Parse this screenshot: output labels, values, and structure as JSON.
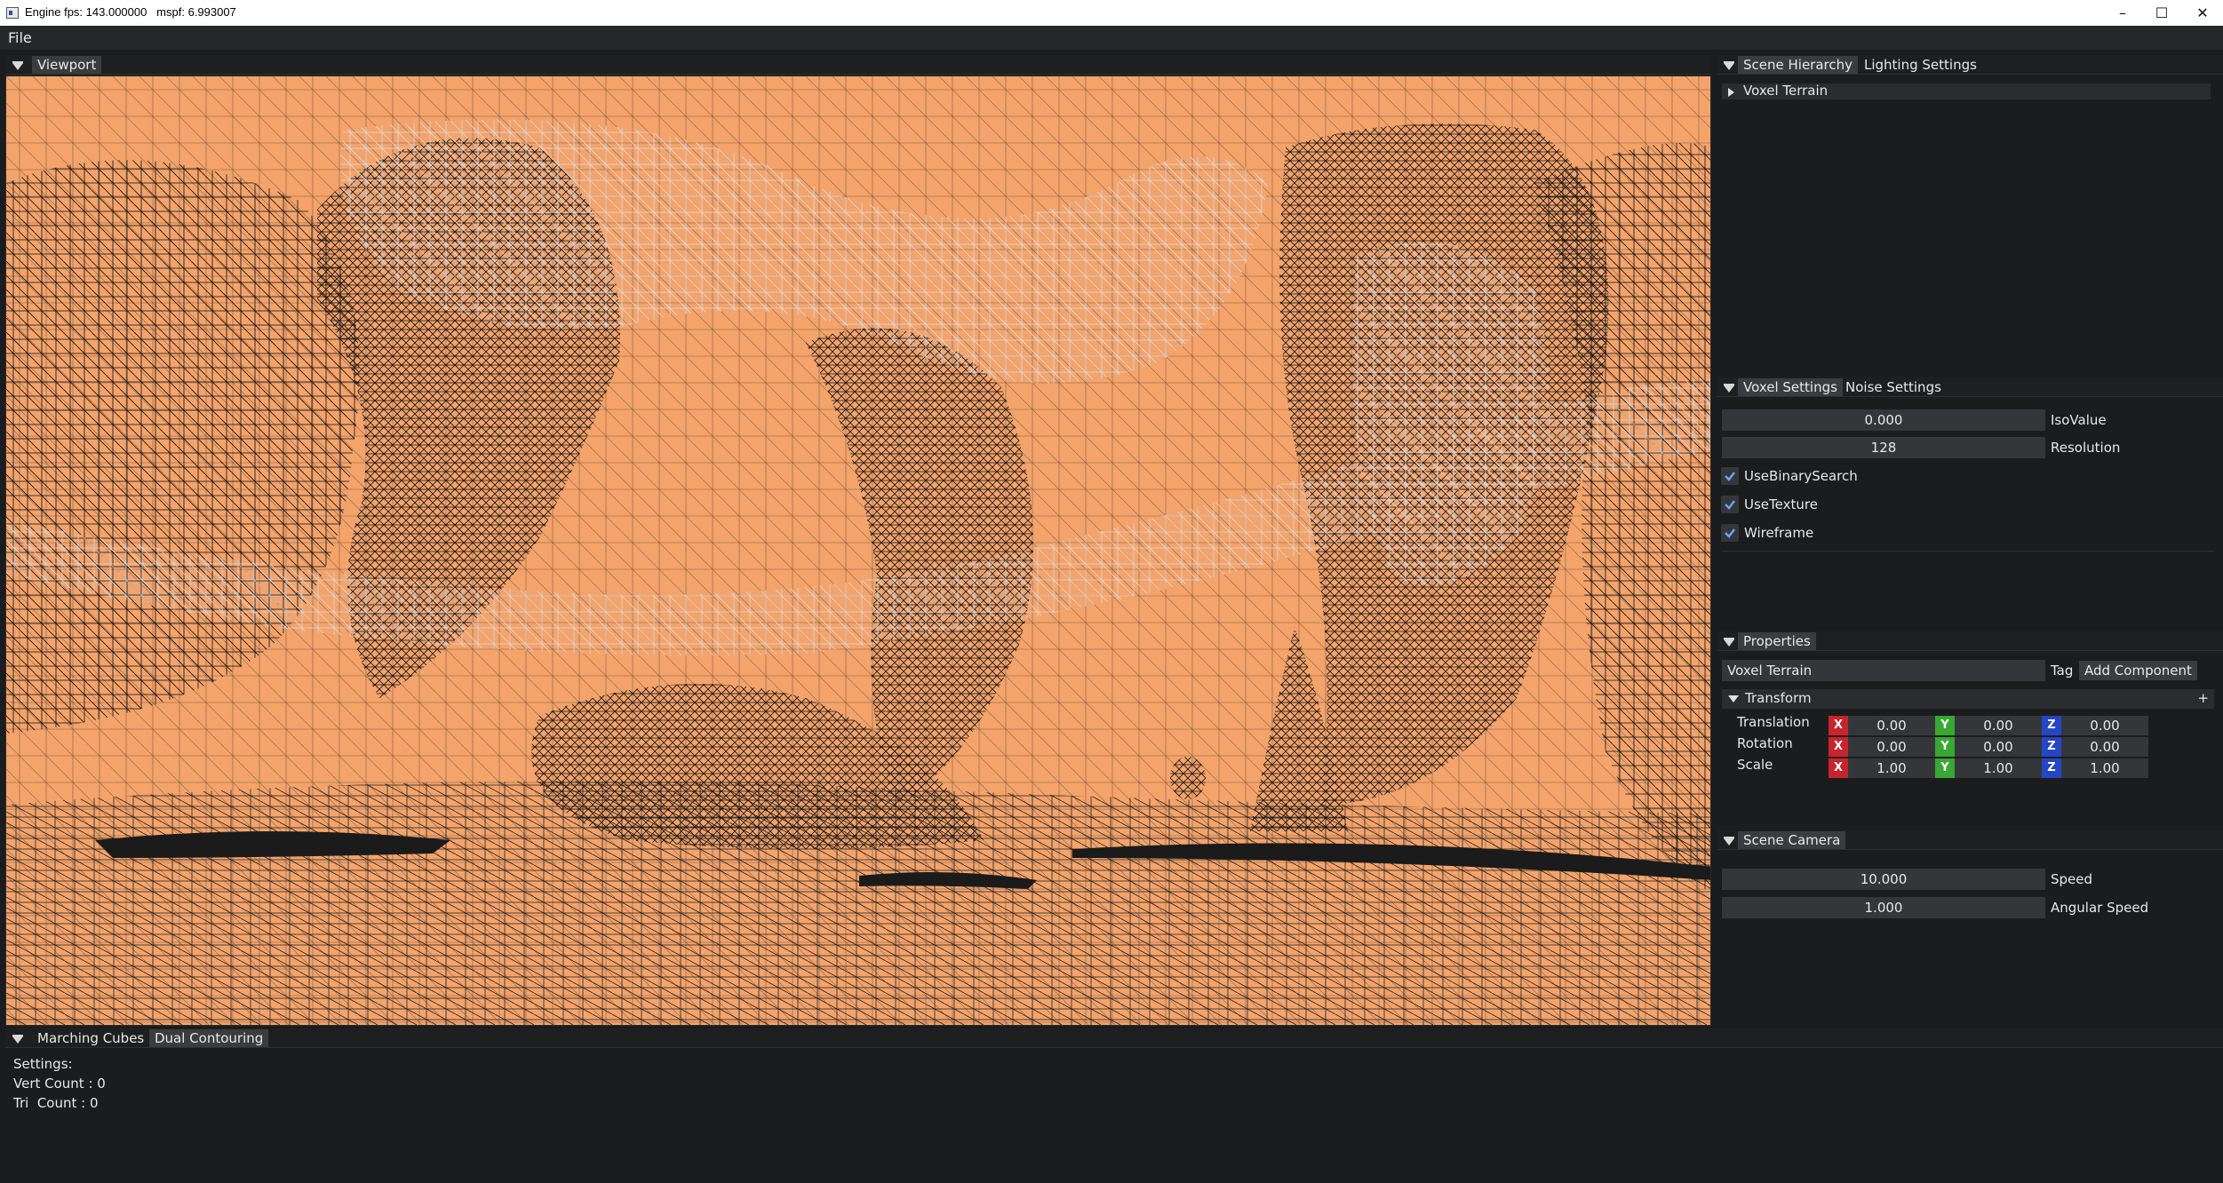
{
  "window": {
    "title": "Engine fps: 143.000000   mspf: 6.993007",
    "controls": {
      "minimize": "–",
      "maximize": "☐",
      "close": "✕"
    }
  },
  "menubar": {
    "file": "File"
  },
  "viewport": {
    "tab": "Viewport",
    "wire_color": "#000000",
    "fill_color": "#f4a36a"
  },
  "hierarchy_panel": {
    "tabs": [
      "Scene Hierarchy",
      "Lighting Settings"
    ],
    "items": [
      "Voxel Terrain"
    ]
  },
  "voxel_panel": {
    "tabs": [
      "Voxel Settings",
      "Noise Settings"
    ],
    "iso_value": "0.000",
    "iso_label": "IsoValue",
    "resolution": "128",
    "resolution_label": "Resolution",
    "checks": [
      {
        "label": "UseBinarySearch",
        "checked": true
      },
      {
        "label": "UseTexture",
        "checked": true
      },
      {
        "label": "Wireframe",
        "checked": true
      }
    ]
  },
  "properties_panel": {
    "tab": "Properties",
    "name_value": "Voxel Terrain",
    "tag_label": "Tag",
    "add_component": "Add Component",
    "transform": {
      "label": "Transform",
      "plus": "+",
      "rows": [
        {
          "label": "Translation",
          "x": "0.00",
          "y": "0.00",
          "z": "0.00"
        },
        {
          "label": "Rotation",
          "x": "0.00",
          "y": "0.00",
          "z": "0.00"
        },
        {
          "label": "Scale",
          "x": "1.00",
          "y": "1.00",
          "z": "1.00"
        }
      ],
      "axis": {
        "x": "X",
        "y": "Y",
        "z": "Z"
      }
    }
  },
  "camera_panel": {
    "tab": "Scene Camera",
    "speed": "10.000",
    "speed_label": "Speed",
    "angular_speed": "1.000",
    "angular_speed_label": "Angular Speed"
  },
  "bottom_panel": {
    "tabs": [
      "Marching Cubes",
      "Dual Contouring"
    ],
    "lines": [
      "Settings:",
      "Vert Count : 0",
      "Tri  Count : 0"
    ]
  }
}
